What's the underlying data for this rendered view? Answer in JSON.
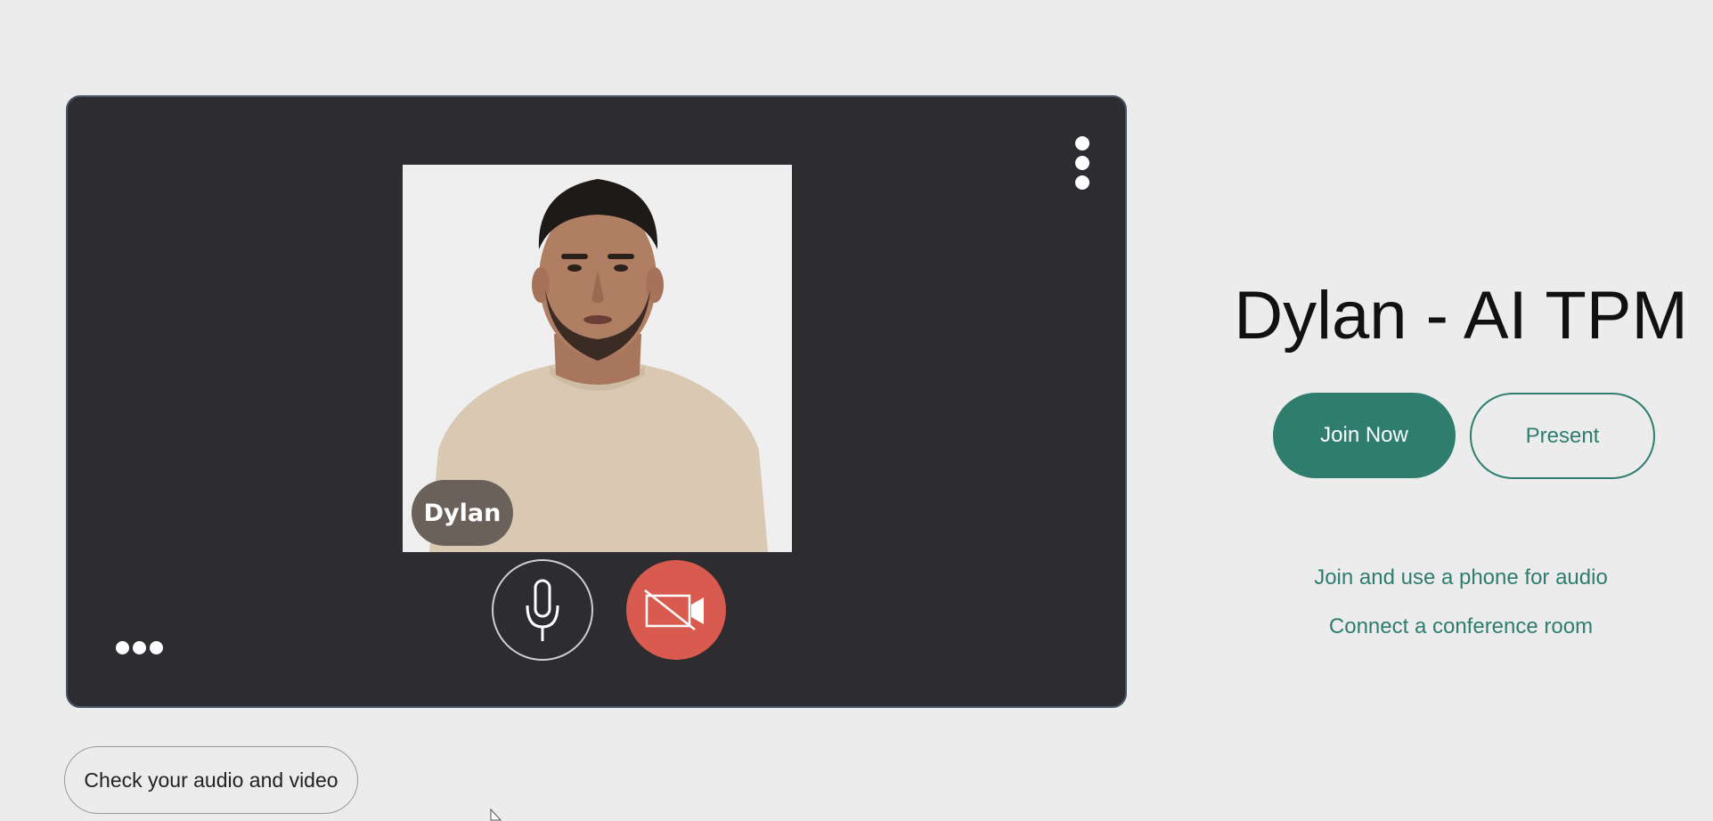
{
  "preview": {
    "participant_name": "Dylan",
    "mic_state": "on",
    "camera_state": "off",
    "icons": {
      "options": "vertical-ellipsis-icon",
      "more": "horizontal-ellipsis-icon",
      "mic": "microphone-icon",
      "camera": "video-camera-off-icon"
    }
  },
  "check_audio_video_label": "Check your audio and video",
  "meeting": {
    "title": "Dylan - AI TPM"
  },
  "actions": {
    "join_label": "Join Now",
    "present_label": "Present"
  },
  "links": {
    "phone_audio": "Join and use a phone for audio",
    "conference_room": "Connect a conference room"
  },
  "colors": {
    "accent": "#2e7d6f",
    "camera_off": "#d95b4f",
    "preview_bg": "#2c2c31",
    "page_bg": "#ececec"
  }
}
